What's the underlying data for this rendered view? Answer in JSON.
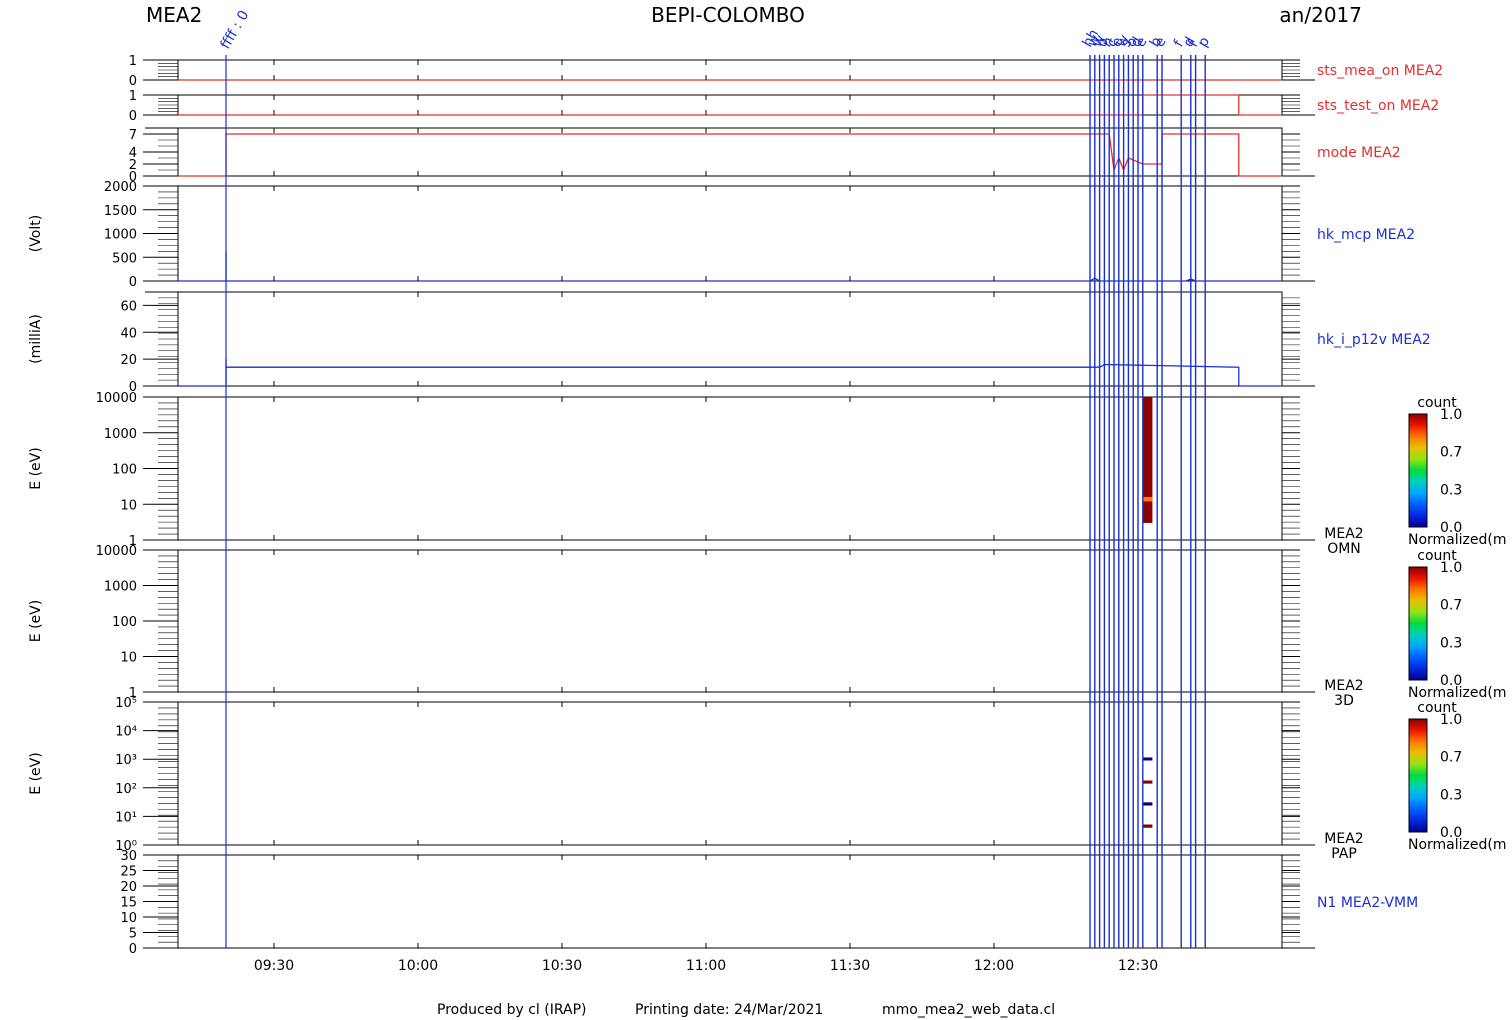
{
  "header": {
    "instrument": "MEA2",
    "mission": "BEPI-COLOMBO",
    "date": "an/2017"
  },
  "footer": {
    "producer": "Produced by cl (IRAP)",
    "printing_date": "Printing date: 24/Mar/2021",
    "script": "mmo_mea2_web_data.cl"
  },
  "colors": {
    "status": "#e03030",
    "mode": "#e03030",
    "mode_dark": "#a00050",
    "housekeeping": "#1a2fd0",
    "frame": "#000000"
  },
  "chart_data": [
    {
      "name": "sts_mea_on MEA2",
      "type": "line",
      "ylabel": "",
      "yticks": [
        "1",
        "0"
      ],
      "ylim": [
        0,
        1
      ],
      "series": [
        {
          "name": "sts_mea_on MEA2",
          "x": [
            "09:10",
            "13:00"
          ],
          "values": [
            0,
            0
          ]
        }
      ]
    },
    {
      "name": "sts_test_on MEA2",
      "type": "line",
      "ylabel": "",
      "yticks": [
        "1",
        "0"
      ],
      "ylim": [
        0,
        1
      ],
      "series": [
        {
          "name": "sts_test_on MEA2",
          "x": [
            "09:10",
            "12:31",
            "12:31",
            "12:51",
            "12:51",
            "13:00"
          ],
          "values": [
            0,
            0,
            1,
            1,
            0,
            0
          ]
        }
      ]
    },
    {
      "name": "mode MEA2",
      "type": "line",
      "ylabel": "",
      "yticks": [
        "7",
        "4",
        "2",
        "0"
      ],
      "ylim": [
        0,
        8
      ],
      "series": [
        {
          "name": "mode MEA2",
          "x": [
            "09:10",
            "09:20",
            "09:20",
            "12:24",
            "12:25",
            "12:26",
            "12:27",
            "12:28",
            "12:31",
            "12:35",
            "12:35",
            "12:51",
            "12:51",
            "13:00"
          ],
          "values": [
            0,
            0,
            7,
            7,
            1,
            3,
            1,
            3,
            2,
            2,
            7,
            7,
            0,
            0
          ]
        }
      ]
    },
    {
      "name": "hk_mcp MEA2",
      "type": "line",
      "ylabel": "(Volt)",
      "yticks": [
        "2000",
        "1500",
        "1000",
        "500",
        "0"
      ],
      "ylim": [
        0,
        2000
      ],
      "series": [
        {
          "name": "hk_mcp MEA2",
          "x": [
            "09:10",
            "09:20",
            "09:20",
            "09:20",
            "12:20",
            "12:21",
            "12:22",
            "12:40",
            "12:41",
            "12:42",
            "13:00"
          ],
          "values": [
            0,
            0,
            600,
            0,
            0,
            60,
            0,
            0,
            40,
            0,
            0
          ]
        }
      ]
    },
    {
      "name": "hk_i_p12v MEA2",
      "type": "line",
      "ylabel": "(milliA)",
      "yticks": [
        "60",
        "40",
        "20",
        "0"
      ],
      "ylim": [
        0,
        70
      ],
      "series": [
        {
          "name": "hk_i_p12v MEA2",
          "x": [
            "09:10",
            "09:20",
            "09:20",
            "09:20",
            "12:22",
            "12:23",
            "12:51",
            "12:51",
            "13:00"
          ],
          "values": [
            0,
            0,
            20,
            14,
            14,
            16,
            14,
            0,
            0
          ]
        }
      ]
    },
    {
      "name": "MEA2 OMN",
      "type": "heatmap",
      "ylabel": "E (eV)",
      "yticks": [
        "10000",
        "1000",
        "100",
        "10",
        "1"
      ],
      "ylim": [
        1,
        10000
      ],
      "yscale": "log",
      "side_label": [
        "MEA2",
        "OMN"
      ],
      "cells": [
        {
          "t_start": "12:31",
          "t_end": "12:33",
          "e_low": 3,
          "e_high": 10000,
          "value": 1.0
        },
        {
          "t_start": "12:31",
          "t_end": "12:33",
          "e_low": 12,
          "e_high": 16,
          "value": 0.8
        }
      ],
      "colorbar": {
        "title": "count",
        "ticks": [
          "1.0",
          "0.7",
          "0.3",
          "0.0"
        ],
        "label": "Normalized(m"
      }
    },
    {
      "name": "MEA2 3D",
      "type": "heatmap",
      "ylabel": "E (eV)",
      "yticks": [
        "10000",
        "1000",
        "100",
        "10",
        "1"
      ],
      "ylim": [
        1,
        10000
      ],
      "yscale": "log",
      "side_label": [
        "MEA2",
        "3D"
      ],
      "cells": [],
      "colorbar": {
        "title": "count",
        "ticks": [
          "1.0",
          "0.7",
          "0.3",
          "0.0"
        ],
        "label": "Normalized(m"
      }
    },
    {
      "name": "MEA2 PAP",
      "type": "heatmap",
      "ylabel": "E (eV)",
      "yticks": [
        "10⁵",
        "10⁴",
        "10³",
        "10²",
        "10¹",
        "10⁰"
      ],
      "ylim": [
        1,
        100000
      ],
      "yscale": "log",
      "side_label": [
        "MEA2",
        "PAP"
      ],
      "cells": [
        {
          "t_start": "12:31",
          "t_end": "12:33",
          "e_low": 900,
          "e_high": 1150,
          "value": 0.0
        },
        {
          "t_start": "12:31",
          "t_end": "12:33",
          "e_low": 140,
          "e_high": 180,
          "value": 1.0
        },
        {
          "t_start": "12:31",
          "t_end": "12:33",
          "e_low": 24,
          "e_high": 31,
          "value": 0.0
        },
        {
          "t_start": "12:31",
          "t_end": "12:33",
          "e_low": 4,
          "e_high": 5.2,
          "value": 1.0
        }
      ],
      "colorbar": {
        "title": "count",
        "ticks": [
          "1.0",
          "0.7",
          "0.3",
          "0.0"
        ],
        "label": "Normalized(m"
      }
    },
    {
      "name": "N1 MEA2-VMM",
      "type": "line",
      "ylabel": "",
      "yticks": [
        "30",
        "25",
        "20",
        "15",
        "10",
        "5",
        "0"
      ],
      "ylim": [
        0,
        30
      ],
      "series": []
    }
  ],
  "time_axis": {
    "xlim": [
      "09:10",
      "13:00"
    ],
    "ticks": [
      "09:30",
      "10:00",
      "10:30",
      "11:00",
      "11:30",
      "12:00",
      "12:30"
    ]
  },
  "events": {
    "first": {
      "time": "09:20",
      "label": "ffff : 0"
    },
    "cluster": [
      {
        "time": "12:20",
        "label": "hh"
      },
      {
        "time": "12:21",
        "label": "w"
      },
      {
        "time": "12:22",
        "label": "w"
      },
      {
        "time": "12:23",
        "label": "o"
      },
      {
        "time": "12:24",
        "label": "n"
      },
      {
        "time": "12:25",
        "label": "c"
      },
      {
        "time": "12:26",
        "label": "e"
      },
      {
        "time": "12:27",
        "label": "w"
      },
      {
        "time": "12:28",
        "label": "s"
      },
      {
        "time": "12:29",
        "label": "o"
      },
      {
        "time": "12:30",
        "label": "d"
      },
      {
        "time": "12:31",
        "label": "e"
      },
      {
        "time": "12:34",
        "label": "b"
      },
      {
        "time": "12:35",
        "label": "e"
      },
      {
        "time": "12:39",
        "label": "f"
      },
      {
        "time": "12:41",
        "label": "d"
      },
      {
        "time": "12:42",
        "label": "f"
      },
      {
        "time": "12:44",
        "label": "p"
      }
    ]
  }
}
